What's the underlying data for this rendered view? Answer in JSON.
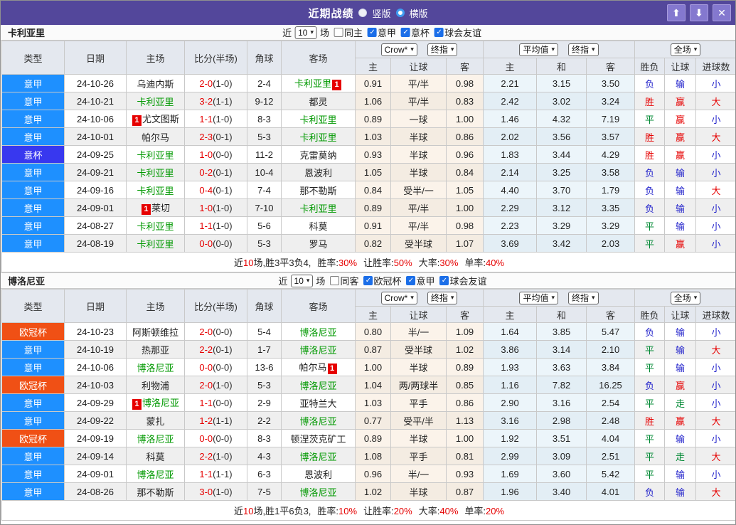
{
  "titlebar": {
    "title": "近期战绩",
    "vertical_label": "竖版",
    "horizontal_label": "横版"
  },
  "icons": {
    "dropdown": "▾",
    "up": "⬆",
    "down": "⬇",
    "close": "✕",
    "check": "✓"
  },
  "colors": {
    "titlebar": "#53479b",
    "accent_green": "#009900",
    "accent_red": "#e60000"
  },
  "type_colors": {
    "意甲": "#1e90ff",
    "意杯": "#3838ef",
    "欧冠杯": "#f05015"
  },
  "result_colors": {
    "胜": "#e60000",
    "平": "#008833",
    "负": "#2525cc",
    "赢": "#e60000",
    "输": "#2525cc",
    "走": "#008833",
    "大": "#e60000",
    "小": "#2525cc"
  },
  "badge_text": "1",
  "selects": {
    "crow": "Crow*",
    "final": "终指",
    "average": "平均值",
    "final2": "终指",
    "scope": "全场"
  },
  "columns": {
    "type": "类型",
    "date": "日期",
    "home": "主场",
    "score": "比分(半场)",
    "corner": "角球",
    "away": "客场",
    "h": "主",
    "handicap": "让球",
    "a": "客",
    "avg_h": "主",
    "avg_d": "和",
    "avg_a": "客",
    "wdl": "胜负",
    "handicap_res": "让球",
    "goals": "进球数"
  },
  "sections": [
    {
      "team": "卡利亚里",
      "filter": {
        "near": "近",
        "count": "10",
        "games": "场",
        "same_label": "同主",
        "same_checked": false,
        "leagues": [
          "意甲",
          "意杯",
          "球会友谊"
        ]
      },
      "rows": [
        {
          "type": "意甲",
          "date": "24-10-26",
          "home": {
            "n": "乌迪内斯"
          },
          "ft": "2-0",
          "ht": "1-0",
          "corner": "2-4",
          "away": {
            "n": "卡利亚里",
            "g": 1,
            "b": "after"
          },
          "odds": [
            "0.91",
            "平/半",
            "0.98"
          ],
          "avg": [
            "2.21",
            "3.15",
            "3.50"
          ],
          "res": [
            "负",
            "输",
            "小"
          ]
        },
        {
          "type": "意甲",
          "date": "24-10-21",
          "home": {
            "n": "卡利亚里",
            "g": 1
          },
          "ft": "3-2",
          "ht": "1-1",
          "corner": "9-12",
          "away": {
            "n": "都灵"
          },
          "odds": [
            "1.06",
            "平/半",
            "0.83"
          ],
          "avg": [
            "2.42",
            "3.02",
            "3.24"
          ],
          "res": [
            "胜",
            "赢",
            "大"
          ]
        },
        {
          "type": "意甲",
          "date": "24-10-06",
          "home": {
            "n": "尤文图斯",
            "b": "before"
          },
          "ft": "1-1",
          "ht": "1-0",
          "corner": "8-3",
          "away": {
            "n": "卡利亚里",
            "g": 1
          },
          "odds": [
            "0.89",
            "一球",
            "1.00"
          ],
          "avg": [
            "1.46",
            "4.32",
            "7.19"
          ],
          "res": [
            "平",
            "赢",
            "小"
          ]
        },
        {
          "type": "意甲",
          "date": "24-10-01",
          "home": {
            "n": "帕尔马"
          },
          "ft": "2-3",
          "ht": "0-1",
          "corner": "5-3",
          "away": {
            "n": "卡利亚里",
            "g": 1
          },
          "odds": [
            "1.03",
            "半球",
            "0.86"
          ],
          "avg": [
            "2.02",
            "3.56",
            "3.57"
          ],
          "res": [
            "胜",
            "赢",
            "大"
          ]
        },
        {
          "type": "意杯",
          "date": "24-09-25",
          "home": {
            "n": "卡利亚里",
            "g": 1
          },
          "ft": "1-0",
          "ht": "0-0",
          "corner": "11-2",
          "away": {
            "n": "克雷莫纳"
          },
          "odds": [
            "0.93",
            "半球",
            "0.96"
          ],
          "avg": [
            "1.83",
            "3.44",
            "4.29"
          ],
          "res": [
            "胜",
            "赢",
            "小"
          ]
        },
        {
          "type": "意甲",
          "date": "24-09-21",
          "home": {
            "n": "卡利亚里",
            "g": 1
          },
          "ft": "0-2",
          "ht": "0-1",
          "corner": "10-4",
          "away": {
            "n": "恩波利"
          },
          "odds": [
            "1.05",
            "半球",
            "0.84"
          ],
          "avg": [
            "2.14",
            "3.25",
            "3.58"
          ],
          "res": [
            "负",
            "输",
            "小"
          ]
        },
        {
          "type": "意甲",
          "date": "24-09-16",
          "home": {
            "n": "卡利亚里",
            "g": 1
          },
          "ft": "0-4",
          "ht": "0-1",
          "corner": "7-4",
          "away": {
            "n": "那不勒斯"
          },
          "odds": [
            "0.84",
            "受半/一",
            "1.05"
          ],
          "avg": [
            "4.40",
            "3.70",
            "1.79"
          ],
          "res": [
            "负",
            "输",
            "大"
          ]
        },
        {
          "type": "意甲",
          "date": "24-09-01",
          "home": {
            "n": "莱切",
            "b": "before"
          },
          "ft": "1-0",
          "ht": "1-0",
          "corner": "7-10",
          "away": {
            "n": "卡利亚里",
            "g": 1
          },
          "odds": [
            "0.89",
            "平/半",
            "1.00"
          ],
          "avg": [
            "2.29",
            "3.12",
            "3.35"
          ],
          "res": [
            "负",
            "输",
            "小"
          ]
        },
        {
          "type": "意甲",
          "date": "24-08-27",
          "home": {
            "n": "卡利亚里",
            "g": 1
          },
          "ft": "1-1",
          "ht": "1-0",
          "corner": "5-6",
          "away": {
            "n": "科莫"
          },
          "odds": [
            "0.91",
            "平/半",
            "0.98"
          ],
          "avg": [
            "2.23",
            "3.29",
            "3.29"
          ],
          "res": [
            "平",
            "输",
            "小"
          ]
        },
        {
          "type": "意甲",
          "date": "24-08-19",
          "home": {
            "n": "卡利亚里",
            "g": 1
          },
          "ft": "0-0",
          "ht": "0-0",
          "corner": "5-3",
          "away": {
            "n": "罗马"
          },
          "odds": [
            "0.82",
            "受半球",
            "1.07"
          ],
          "avg": [
            "3.69",
            "3.42",
            "2.03"
          ],
          "res": [
            "平",
            "赢",
            "小"
          ]
        }
      ],
      "summary": {
        "near": "近",
        "count": "10",
        "record": "场,胜3平3负4,",
        "stats": [
          {
            "label": "胜率:",
            "value": "30%"
          },
          {
            "label": "让胜率:",
            "value": "50%"
          },
          {
            "label": "大率:",
            "value": "30%"
          },
          {
            "label": "单率:",
            "value": "40%"
          }
        ]
      }
    },
    {
      "team": "博洛尼亚",
      "filter": {
        "near": "近",
        "count": "10",
        "games": "场",
        "same_label": "同客",
        "same_checked": false,
        "leagues": [
          "欧冠杯",
          "意甲",
          "球会友谊"
        ]
      },
      "rows": [
        {
          "type": "欧冠杯",
          "date": "24-10-23",
          "home": {
            "n": "阿斯顿维拉"
          },
          "ft": "2-0",
          "ht": "0-0",
          "corner": "5-4",
          "away": {
            "n": "博洛尼亚",
            "g": 1
          },
          "odds": [
            "0.80",
            "半/一",
            "1.09"
          ],
          "avg": [
            "1.64",
            "3.85",
            "5.47"
          ],
          "res": [
            "负",
            "输",
            "小"
          ]
        },
        {
          "type": "意甲",
          "date": "24-10-19",
          "home": {
            "n": "热那亚"
          },
          "ft": "2-2",
          "ht": "0-1",
          "corner": "1-7",
          "away": {
            "n": "博洛尼亚",
            "g": 1
          },
          "odds": [
            "0.87",
            "受半球",
            "1.02"
          ],
          "avg": [
            "3.86",
            "3.14",
            "2.10"
          ],
          "res": [
            "平",
            "输",
            "大"
          ]
        },
        {
          "type": "意甲",
          "date": "24-10-06",
          "home": {
            "n": "博洛尼亚",
            "g": 1
          },
          "ft": "0-0",
          "ht": "0-0",
          "corner": "13-6",
          "away": {
            "n": "帕尔马",
            "b": "after"
          },
          "odds": [
            "1.00",
            "半球",
            "0.89"
          ],
          "avg": [
            "1.93",
            "3.63",
            "3.84"
          ],
          "res": [
            "平",
            "输",
            "小"
          ]
        },
        {
          "type": "欧冠杯",
          "date": "24-10-03",
          "home": {
            "n": "利物浦"
          },
          "ft": "2-0",
          "ht": "1-0",
          "corner": "5-3",
          "away": {
            "n": "博洛尼亚",
            "g": 1
          },
          "odds": [
            "1.04",
            "两/两球半",
            "0.85"
          ],
          "avg": [
            "1.16",
            "7.82",
            "16.25"
          ],
          "res": [
            "负",
            "赢",
            "小"
          ]
        },
        {
          "type": "意甲",
          "date": "24-09-29",
          "home": {
            "n": "博洛尼亚",
            "g": 1,
            "b": "before"
          },
          "ft": "1-1",
          "ht": "0-0",
          "corner": "2-9",
          "away": {
            "n": "亚特兰大"
          },
          "odds": [
            "1.03",
            "平手",
            "0.86"
          ],
          "avg": [
            "2.90",
            "3.16",
            "2.54"
          ],
          "res": [
            "平",
            "走",
            "小"
          ]
        },
        {
          "type": "意甲",
          "date": "24-09-22",
          "home": {
            "n": "蒙扎"
          },
          "ft": "1-2",
          "ht": "1-1",
          "corner": "2-2",
          "away": {
            "n": "博洛尼亚",
            "g": 1
          },
          "odds": [
            "0.77",
            "受平/半",
            "1.13"
          ],
          "avg": [
            "3.16",
            "2.98",
            "2.48"
          ],
          "res": [
            "胜",
            "赢",
            "大"
          ]
        },
        {
          "type": "欧冠杯",
          "date": "24-09-19",
          "home": {
            "n": "博洛尼亚",
            "g": 1
          },
          "ft": "0-0",
          "ht": "0-0",
          "corner": "8-3",
          "away": {
            "n": "顿涅茨克矿工"
          },
          "odds": [
            "0.89",
            "半球",
            "1.00"
          ],
          "avg": [
            "1.92",
            "3.51",
            "4.04"
          ],
          "res": [
            "平",
            "输",
            "小"
          ]
        },
        {
          "type": "意甲",
          "date": "24-09-14",
          "home": {
            "n": "科莫"
          },
          "ft": "2-2",
          "ht": "1-0",
          "corner": "4-3",
          "away": {
            "n": "博洛尼亚",
            "g": 1
          },
          "odds": [
            "1.08",
            "平手",
            "0.81"
          ],
          "avg": [
            "2.99",
            "3.09",
            "2.51"
          ],
          "res": [
            "平",
            "走",
            "大"
          ]
        },
        {
          "type": "意甲",
          "date": "24-09-01",
          "home": {
            "n": "博洛尼亚",
            "g": 1
          },
          "ft": "1-1",
          "ht": "1-1",
          "corner": "6-3",
          "away": {
            "n": "恩波利"
          },
          "odds": [
            "0.96",
            "半/一",
            "0.93"
          ],
          "avg": [
            "1.69",
            "3.60",
            "5.42"
          ],
          "res": [
            "平",
            "输",
            "小"
          ]
        },
        {
          "type": "意甲",
          "date": "24-08-26",
          "home": {
            "n": "那不勒斯"
          },
          "ft": "3-0",
          "ht": "1-0",
          "corner": "7-5",
          "away": {
            "n": "博洛尼亚",
            "g": 1
          },
          "odds": [
            "1.02",
            "半球",
            "0.87"
          ],
          "avg": [
            "1.96",
            "3.40",
            "4.01"
          ],
          "res": [
            "负",
            "输",
            "大"
          ]
        }
      ],
      "summary": {
        "near": "近",
        "count": "10",
        "record": "场,胜1平6负3,",
        "stats": [
          {
            "label": "胜率:",
            "value": "10%"
          },
          {
            "label": "让胜率:",
            "value": "20%"
          },
          {
            "label": "大率:",
            "value": "40%"
          },
          {
            "label": "单率:",
            "value": "20%"
          }
        ]
      }
    }
  ]
}
